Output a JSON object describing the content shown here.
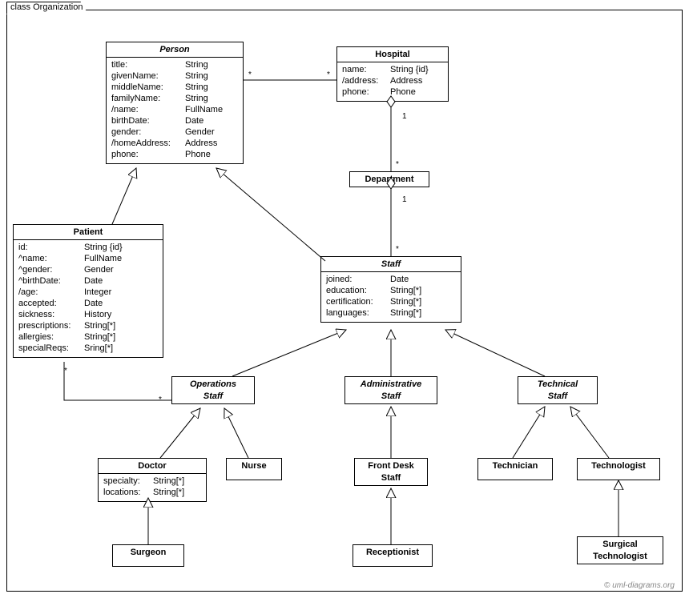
{
  "frame": {
    "title": "class Organization"
  },
  "classes": {
    "person": {
      "name": "Person",
      "attrs": [
        {
          "n": "title:",
          "t": "String"
        },
        {
          "n": "givenName:",
          "t": "String"
        },
        {
          "n": "middleName:",
          "t": "String"
        },
        {
          "n": "familyName:",
          "t": "String"
        },
        {
          "n": "/name:",
          "t": "FullName"
        },
        {
          "n": "birthDate:",
          "t": "Date"
        },
        {
          "n": "gender:",
          "t": "Gender"
        },
        {
          "n": "/homeAddress:",
          "t": "Address"
        },
        {
          "n": "phone:",
          "t": "Phone"
        }
      ]
    },
    "hospital": {
      "name": "Hospital",
      "attrs": [
        {
          "n": "name:",
          "t": "String {id}"
        },
        {
          "n": "/address:",
          "t": "Address"
        },
        {
          "n": "phone:",
          "t": "Phone"
        }
      ]
    },
    "department": {
      "name": "Department"
    },
    "patient": {
      "name": "Patient",
      "attrs": [
        {
          "n": "id:",
          "t": "String {id}"
        },
        {
          "n": "^name:",
          "t": "FullName"
        },
        {
          "n": "^gender:",
          "t": "Gender"
        },
        {
          "n": "^birthDate:",
          "t": "Date"
        },
        {
          "n": "/age:",
          "t": "Integer"
        },
        {
          "n": "accepted:",
          "t": "Date"
        },
        {
          "n": "sickness:",
          "t": "History"
        },
        {
          "n": "prescriptions:",
          "t": "String[*]"
        },
        {
          "n": "allergies:",
          "t": "String[*]"
        },
        {
          "n": "specialReqs:",
          "t": "Sring[*]"
        }
      ]
    },
    "staff": {
      "name": "Staff",
      "attrs": [
        {
          "n": "joined:",
          "t": "Date"
        },
        {
          "n": "education:",
          "t": "String[*]"
        },
        {
          "n": "certification:",
          "t": "String[*]"
        },
        {
          "n": "languages:",
          "t": "String[*]"
        }
      ]
    },
    "ops": {
      "name": "Operations",
      "name2": "Staff"
    },
    "admin": {
      "name": "Administrative",
      "name2": "Staff"
    },
    "tech": {
      "name": "Technical",
      "name2": "Staff"
    },
    "doctor": {
      "name": "Doctor",
      "attrs": [
        {
          "n": "specialty:",
          "t": "String[*]"
        },
        {
          "n": "locations:",
          "t": "String[*]"
        }
      ]
    },
    "nurse": {
      "name": "Nurse"
    },
    "frontdesk": {
      "name": "Front Desk",
      "name2": "Staff"
    },
    "receptionist": {
      "name": "Receptionist"
    },
    "technician": {
      "name": "Technician"
    },
    "technologist": {
      "name": "Technologist"
    },
    "surgtech": {
      "name": "Surgical",
      "name2": "Technologist"
    },
    "surgeon": {
      "name": "Surgeon"
    }
  },
  "mult": {
    "m1": "*",
    "m2": "*",
    "m3": "1",
    "m4": "*",
    "m5": "1",
    "m6": "*",
    "m7": "*",
    "m8": "*"
  },
  "watermark": "© uml-diagrams.org"
}
